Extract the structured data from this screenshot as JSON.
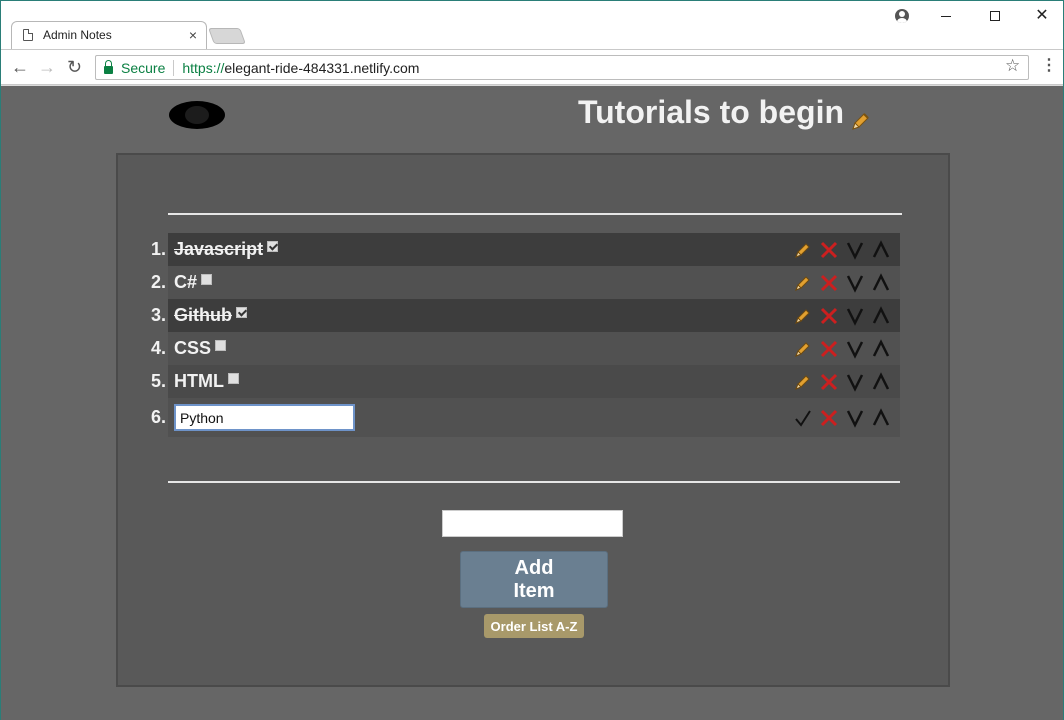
{
  "browser": {
    "tab_title": "Admin Notes",
    "tab_close": "×",
    "secure_label": "Secure",
    "url_protocol": "https://",
    "url_host": "elegant-ride-484331.netlify.com",
    "icons": {
      "back": "←",
      "forward": "→",
      "reload": "↻",
      "star": "☆",
      "menu": "⋮",
      "close": "✕"
    }
  },
  "page": {
    "title": "Tutorials to begin",
    "items": [
      {
        "num": "1.",
        "label": "Javascript",
        "done": true
      },
      {
        "num": "2.",
        "label": "C#",
        "done": false
      },
      {
        "num": "3.",
        "label": "Github",
        "done": true
      },
      {
        "num": "4.",
        "label": "CSS",
        "done": false
      },
      {
        "num": "5.",
        "label": "HTML",
        "done": false
      },
      {
        "num": "6.",
        "edit_value": "Python"
      }
    ],
    "add_input_value": "",
    "add_button_label": "Add Item",
    "order_button_label": "Order List A-Z"
  },
  "colors": {
    "page_bg": "#666666",
    "panel_bg": "#595959",
    "row_dark": "#3d3d3d",
    "row_light": "#515151",
    "edit_icon": "#e2a030",
    "delete_icon": "#cc1f1f",
    "arrow_icon": "#111111",
    "add_button": "#6a7f91",
    "order_button": "#a8996a"
  }
}
